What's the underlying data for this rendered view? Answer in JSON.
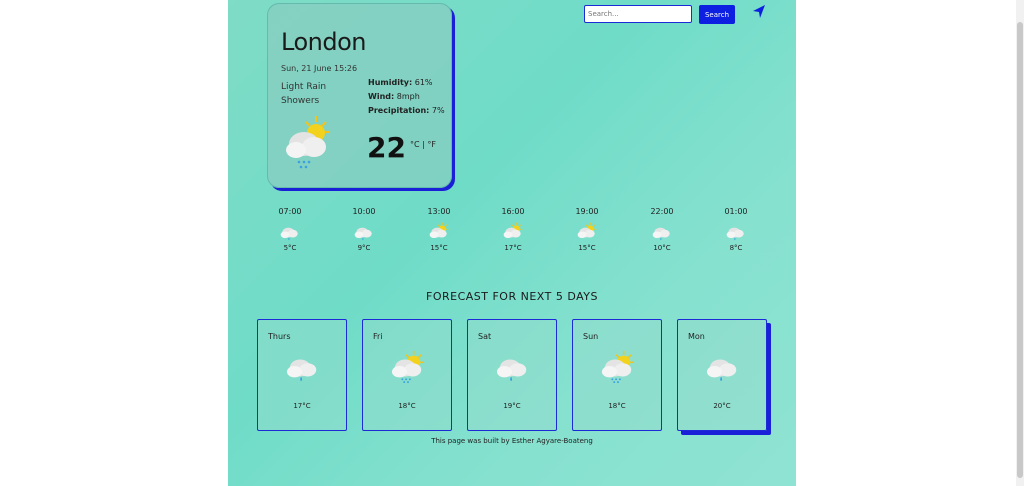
{
  "search": {
    "placeholder": "Search...",
    "button_label": "Search"
  },
  "current": {
    "city": "London",
    "date": "Sun, 21 June 15:26",
    "description": "Light Rain Showers",
    "humidity_label": "Humidity:",
    "humidity": "61%",
    "wind_label": "Wind:",
    "wind": "8mph",
    "precip_label": "Precipitation:",
    "precip": "7%",
    "temperature": "22",
    "units": "°C | °F",
    "icon": "sun-cloud-rain-icon"
  },
  "hourly": [
    {
      "time": "07:00",
      "temp": "5°C",
      "icon": "cloud-rain-icon"
    },
    {
      "time": "10:00",
      "temp": "9°C",
      "icon": "cloud-rain-icon"
    },
    {
      "time": "13:00",
      "temp": "15°C",
      "icon": "sun-cloud-icon"
    },
    {
      "time": "16:00",
      "temp": "17°C",
      "icon": "sun-cloud-icon"
    },
    {
      "time": "19:00",
      "temp": "15°C",
      "icon": "sun-cloud-icon"
    },
    {
      "time": "22:00",
      "temp": "10°C",
      "icon": "cloud-rain-icon"
    },
    {
      "time": "01:00",
      "temp": "8°C",
      "icon": "cloud-rain-icon"
    }
  ],
  "forecast_title": "FORECAST FOR NEXT 5 DAYS",
  "forecast": [
    {
      "day": "Thurs",
      "temp": "17°C",
      "icon": "cloud-rain-icon"
    },
    {
      "day": "Fri",
      "temp": "18°C",
      "icon": "sun-cloud-rain-icon"
    },
    {
      "day": "Sat",
      "temp": "19°C",
      "icon": "cloud-rain-icon"
    },
    {
      "day": "Sun",
      "temp": "18°C",
      "icon": "sun-cloud-rain-icon"
    },
    {
      "day": "Mon",
      "temp": "20°C",
      "icon": "cloud-rain-icon"
    }
  ],
  "footer": "This page was built by Esther Agyare-Boateng",
  "colors": {
    "accent": "#0d1fe0",
    "background": "#7fdcc6"
  }
}
